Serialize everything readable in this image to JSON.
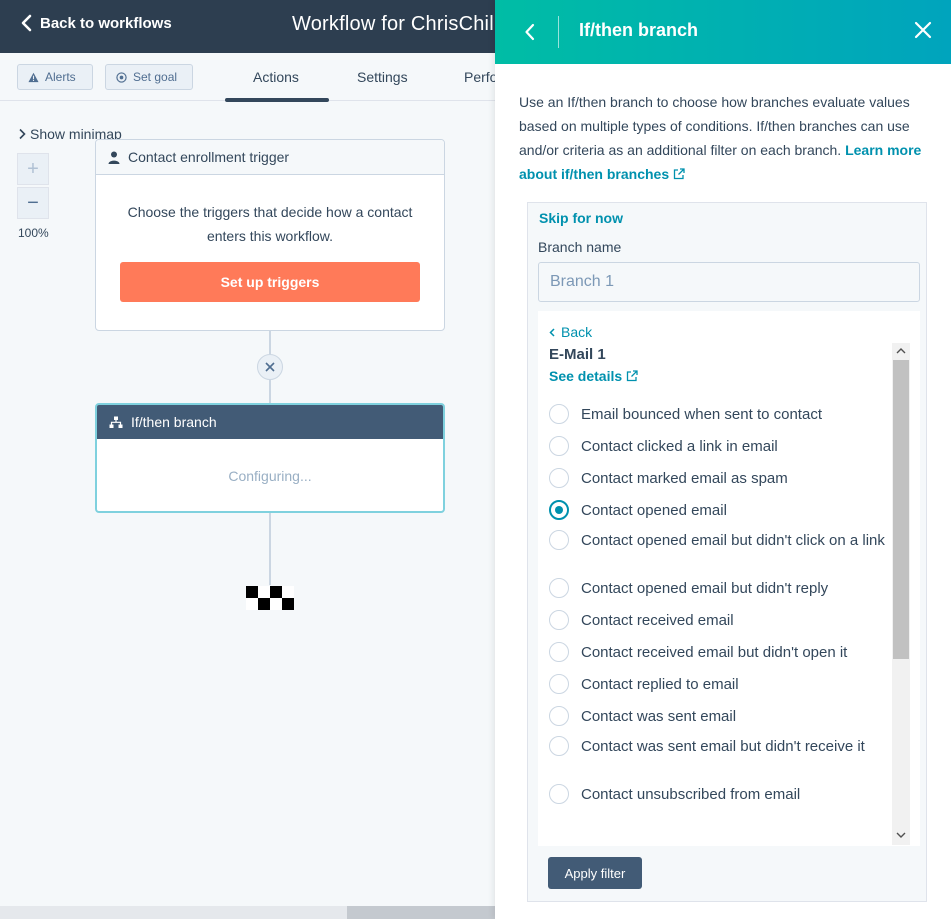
{
  "header": {
    "back_label": "Back to workflows",
    "workflow_title": "Workflow for ChrisChil"
  },
  "subnav": {
    "alerts_label": "Alerts",
    "set_goal_label": "Set goal",
    "tabs": [
      {
        "label": "Actions",
        "active": true
      },
      {
        "label": "Settings",
        "active": false
      },
      {
        "label": "Perfo",
        "active": false
      }
    ]
  },
  "canvas": {
    "minimap_label": "Show minimap",
    "zoom_in": "+",
    "zoom_out": "−",
    "zoom_level": "100%",
    "trigger_card": {
      "title": "Contact enrollment trigger",
      "body": "Choose the triggers that decide how a contact enters this workflow.",
      "button_label": "Set up triggers"
    },
    "branch_card": {
      "title": "If/then branch",
      "status": "Configuring..."
    }
  },
  "panel": {
    "title": "If/then branch",
    "description": "Use an If/then branch to choose how branches evaluate values based on multiple types of conditions. If/then branches can use and/or criteria as an additional filter on each branch.",
    "learn_more_label": "Learn more about if/then branches",
    "skip_label": "Skip for now",
    "branch_name_label": "Branch name",
    "branch_name_placeholder": "Branch 1",
    "filter": {
      "back_label": "Back",
      "email_name": "E-Mail 1",
      "see_details_label": "See details",
      "options": [
        {
          "label": "Email bounced when sent to contact",
          "selected": false
        },
        {
          "label": "Contact clicked a link in email",
          "selected": false
        },
        {
          "label": "Contact marked email as spam",
          "selected": false
        },
        {
          "label": "Contact opened email",
          "selected": true
        },
        {
          "label": "Contact opened email but didn't click on a link",
          "selected": false
        },
        {
          "label": "Contact opened email but didn't reply",
          "selected": false
        },
        {
          "label": "Contact received email",
          "selected": false
        },
        {
          "label": "Contact received email but didn't open it",
          "selected": false
        },
        {
          "label": "Contact replied to email",
          "selected": false
        },
        {
          "label": "Contact was sent email",
          "selected": false
        },
        {
          "label": "Contact was sent email but didn't receive it",
          "selected": false
        },
        {
          "label": "Contact unsubscribed from email",
          "selected": false
        }
      ],
      "apply_label": "Apply filter"
    }
  },
  "colors": {
    "header_bg": "#2d3e50",
    "accent_teal": "#00a4bd",
    "link": "#0091ae",
    "trigger_button": "#ff7a59",
    "branch_header": "#425b76"
  }
}
